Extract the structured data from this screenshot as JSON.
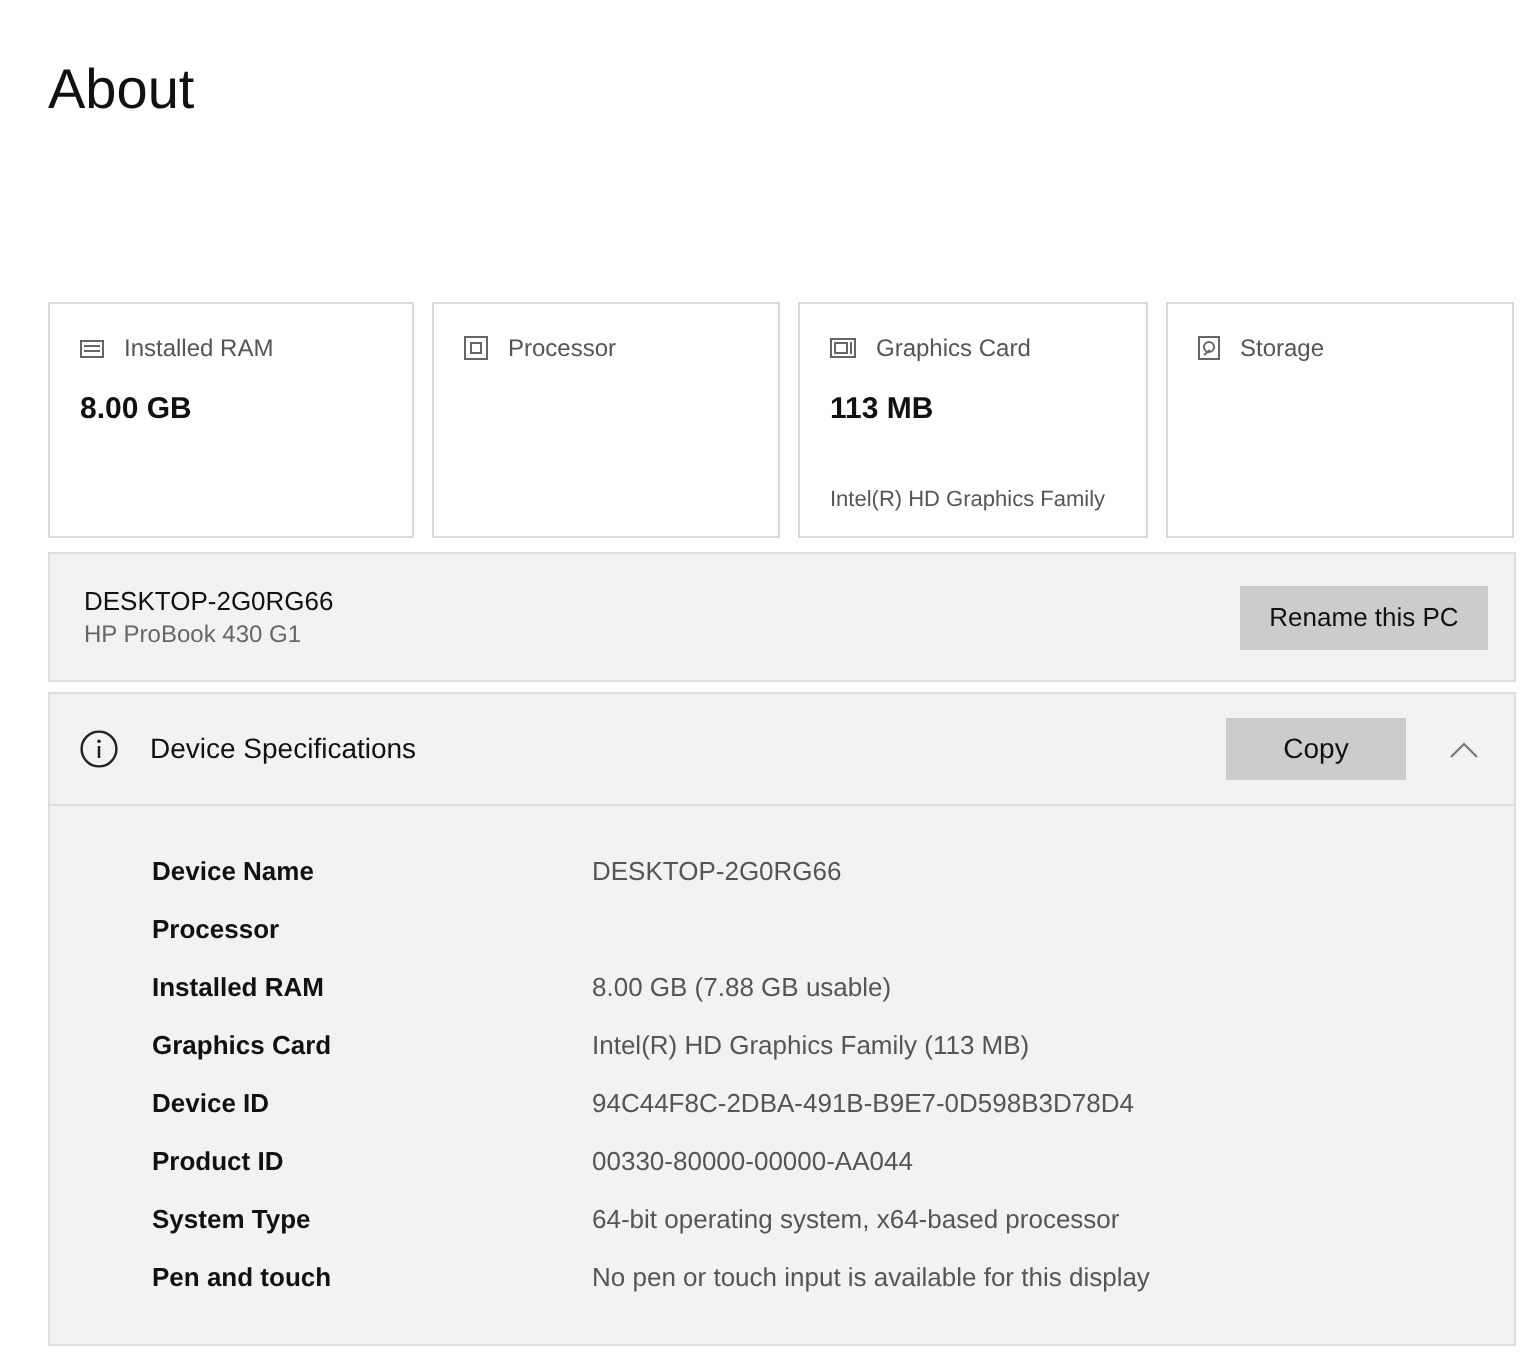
{
  "page": {
    "title": "About"
  },
  "summary_cards": [
    {
      "kind": "ram",
      "label": "Installed RAM",
      "value": "8.00 GB"
    },
    {
      "kind": "processor",
      "label": "Processor"
    },
    {
      "kind": "graphics",
      "label": "Graphics Card",
      "value": "113 MB",
      "detail": "Intel(R) HD Graphics Family"
    },
    {
      "kind": "storage",
      "label": "Storage"
    }
  ],
  "device": {
    "name": "DESKTOP-2G0RG66",
    "model": "HP ProBook 430 G1",
    "button": "Rename this PC"
  },
  "specifications": {
    "title": "Device Specifications",
    "button": "Copy",
    "expanded": true,
    "rows": [
      {
        "label": "Device Name",
        "value": "DESKTOP-2G0RG66"
      },
      {
        "label": "Processor"
      },
      {
        "label": "Installed RAM",
        "value": "8.00 GB (7.88 GB usable)"
      },
      {
        "label": "Graphics Card",
        "value": "Intel(R) HD Graphics Family (113 MB)"
      },
      {
        "label": "Device ID",
        "value": "94C44F8C-2DBA-491B-B9E7-0D598B3D78D4"
      },
      {
        "label": "Product ID",
        "value": "00330-80000-00000-AA044"
      },
      {
        "label": "System Type",
        "value": "64-bit operating system, x64-based processor"
      },
      {
        "label": "Pen and touch",
        "value": "No pen or touch input is available for this display"
      }
    ]
  }
}
